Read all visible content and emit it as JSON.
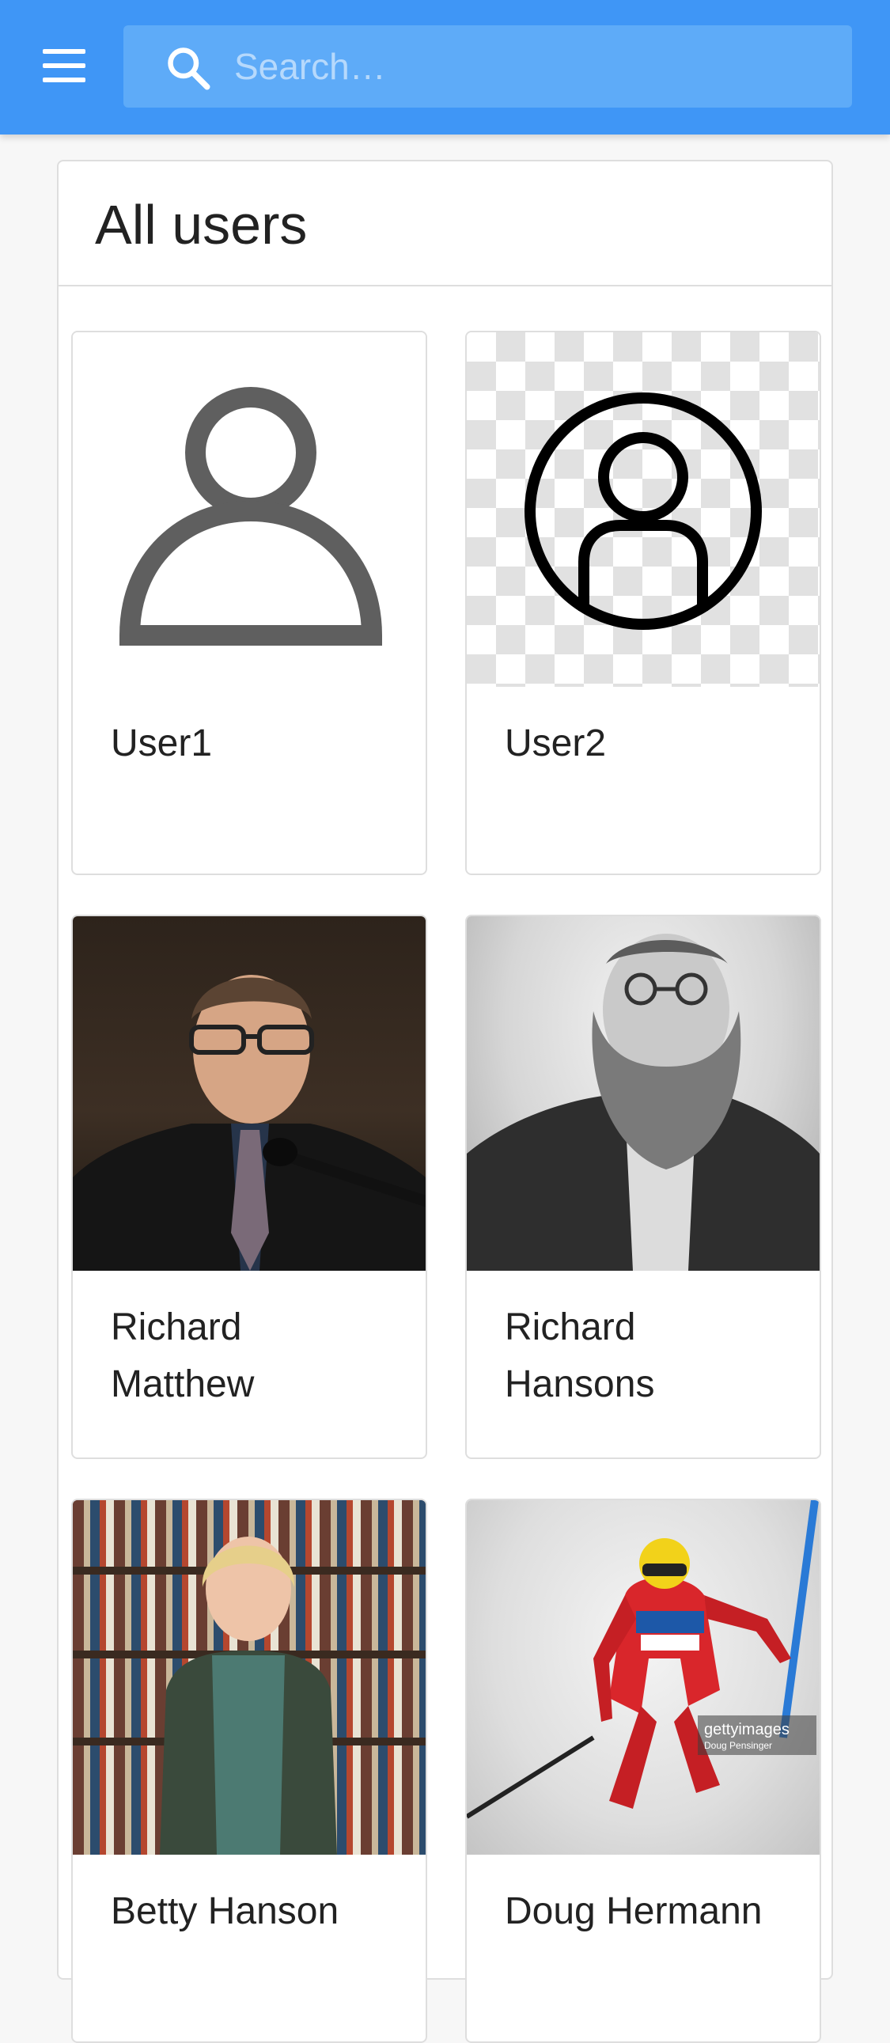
{
  "appbar": {
    "background_color": "#3f96f6",
    "menu_icon": "hamburger-menu-icon",
    "search": {
      "icon": "search-icon",
      "placeholder": "Search…",
      "value": ""
    }
  },
  "panel": {
    "title": "All users"
  },
  "users": [
    {
      "name": "User1",
      "avatar": "default-user-icon"
    },
    {
      "name": "User2",
      "avatar": "user-circle-icon"
    },
    {
      "name": "Richard Matthew",
      "avatar": "photo"
    },
    {
      "name": "Richard Hansons",
      "avatar": "photo"
    },
    {
      "name": "Betty Hanson",
      "avatar": "photo"
    },
    {
      "name": "Doug Hermann",
      "avatar": "photo"
    }
  ],
  "photo_watermark": {
    "brand": "gettyimages",
    "credit": "Doug Pensinger"
  }
}
